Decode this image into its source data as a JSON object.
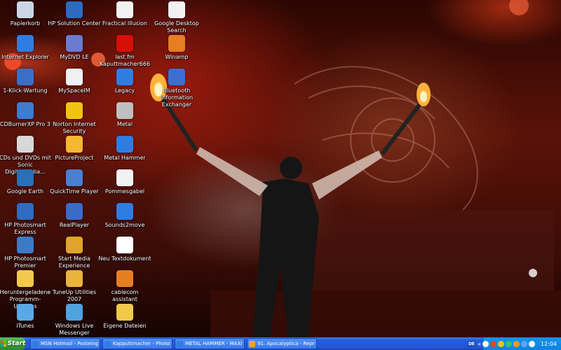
{
  "desktop": {
    "icons": [
      {
        "label": "Papierkorb",
        "icon": "recycle-bin-icon",
        "color": "#c9d6e4"
      },
      {
        "label": "Internet Explorer",
        "icon": "internet-explorer-icon",
        "color": "#2f7de1"
      },
      {
        "label": "1-Klick-Wartung",
        "icon": "maintenance-icon",
        "color": "#3a6fc9"
      },
      {
        "label": "CDBurnerXP Pro 3",
        "icon": "cd-burner-icon",
        "color": "#3d7cd0"
      },
      {
        "label": "CDs und DVDs mit Sonic DigitalMedia...",
        "icon": "disc-icon",
        "color": "#d8d8d8"
      },
      {
        "label": "Google Earth",
        "icon": "google-earth-icon",
        "color": "#2a6fb8"
      },
      {
        "label": "HP Photosmart Express",
        "icon": "hp-photosmart-icon",
        "color": "#2d6cc0"
      },
      {
        "label": "HP Photosmart Premier",
        "icon": "hp-photosmart-premier-icon",
        "color": "#3b7ac5"
      },
      {
        "label": "Heruntergeladene Programm-Updates",
        "icon": "folder-icon",
        "color": "#f2c94c"
      },
      {
        "label": "iTunes",
        "icon": "itunes-icon",
        "color": "#5aa9e6"
      },
      {
        "label": "HP Solution Center",
        "icon": "hp-solution-center-icon",
        "color": "#2c6bc0"
      },
      {
        "label": "MyDVD LE",
        "icon": "dvd-icon",
        "color": "#6a7bd0"
      },
      {
        "label": "MySpaceIM",
        "icon": "myspace-icon",
        "color": "#f0f0f0"
      },
      {
        "label": "Norton Internet Security",
        "icon": "norton-icon",
        "color": "#f1c40f"
      },
      {
        "label": "PictureProject",
        "icon": "picture-project-icon",
        "color": "#f7b731"
      },
      {
        "label": "QuickTime Player",
        "icon": "quicktime-icon",
        "color": "#4a7fd1"
      },
      {
        "label": "RealPlayer",
        "icon": "realplayer-icon",
        "color": "#3a6bc7"
      },
      {
        "label": "Start Media Experience",
        "icon": "media-experience-icon",
        "color": "#e0a42a"
      },
      {
        "label": "TuneUp Utilities 2007",
        "icon": "tuneup-icon",
        "color": "#e8b43a"
      },
      {
        "label": "Windows Live Messenger",
        "icon": "messenger-icon",
        "color": "#4fa3df"
      },
      {
        "label": "Fractical Illusion",
        "icon": "document-icon",
        "color": "#f2f2f2"
      },
      {
        "label": "last.fm Kaputtmacher666",
        "icon": "lastfm-icon",
        "color": "#d51007"
      },
      {
        "label": "Legacy",
        "icon": "internet-shortcut-icon",
        "color": "#2f7de1"
      },
      {
        "label": "Metal",
        "icon": "metal-icon",
        "color": "#bfbfbf"
      },
      {
        "label": "Metal Hammer",
        "icon": "internet-shortcut-icon",
        "color": "#2f7de1"
      },
      {
        "label": "Pommesgabel",
        "icon": "document-icon",
        "color": "#f2f2f2"
      },
      {
        "label": "Sounds2move",
        "icon": "internet-shortcut-icon",
        "color": "#2f7de1"
      },
      {
        "label": "Neu Textdokument",
        "icon": "text-document-icon",
        "color": "#ffffff"
      },
      {
        "label": "cablecom assistant",
        "icon": "cablecom-icon",
        "color": "#e67e22"
      },
      {
        "label": "Eigene Dateien",
        "icon": "my-documents-icon",
        "color": "#f2c94c"
      },
      {
        "label": "Google Desktop Search",
        "icon": "google-desktop-icon",
        "color": "#f2f2f2"
      },
      {
        "label": "Winamp",
        "icon": "winamp-icon",
        "color": "#e67e22"
      },
      {
        "label": "Bluetooth Information Exchanger",
        "icon": "bluetooth-icon",
        "color": "#3d6fd1"
      }
    ]
  },
  "taskbar": {
    "start_label": "Start",
    "tasks": [
      {
        "label": "MSN Hotmail - Posteinga...",
        "icon": "msn-icon",
        "color": "#2f7de1"
      },
      {
        "label": "Kapputtmacher - Photob...",
        "icon": "ie-icon",
        "color": "#2f7de1"
      },
      {
        "label": "METAL HAMMER - MAXI...",
        "icon": "ie-icon",
        "color": "#2f7de1"
      },
      {
        "label": "91. Apocalyptica - Repre...",
        "icon": "ie-icon",
        "color": "#f2a23a"
      }
    ],
    "tray": {
      "lang": "DE",
      "icons": [
        {
          "icon": "tray-1-icon",
          "color": "#f5f5f5"
        },
        {
          "icon": "tray-2-icon",
          "color": "#e0452c"
        },
        {
          "icon": "tray-3-icon",
          "color": "#f1c40f"
        },
        {
          "icon": "tray-4-icon",
          "color": "#3ac26a"
        },
        {
          "icon": "tray-5-icon",
          "color": "#f59b2b"
        },
        {
          "icon": "tray-6-icon",
          "color": "#5fa8ef"
        },
        {
          "icon": "tray-7-icon",
          "color": "#ffffff"
        }
      ],
      "clock": "12:04"
    }
  }
}
